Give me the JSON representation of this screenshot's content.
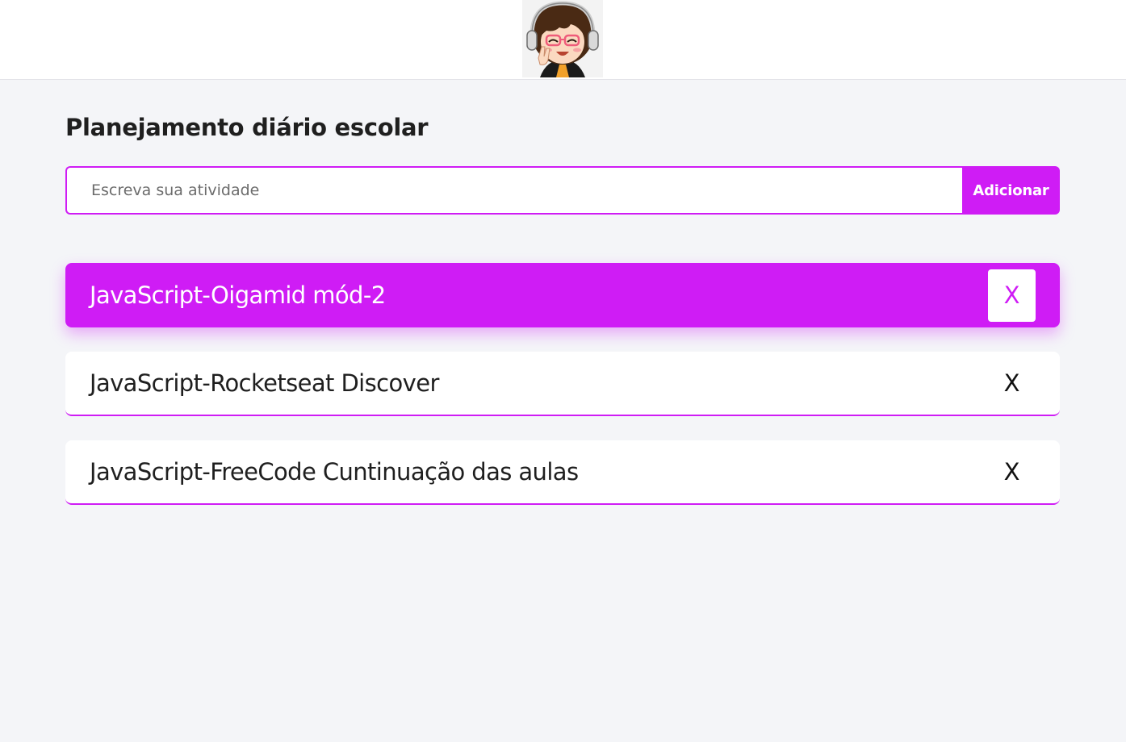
{
  "header": {
    "avatar_alt": "avatar"
  },
  "main": {
    "title": "Planejamento diário escolar",
    "input": {
      "placeholder": "Escreva sua atividade",
      "value": ""
    },
    "add_button_label": "Adicionar",
    "tasks": [
      {
        "label": "JavaScript-Oigamid mód-2",
        "done": true,
        "delete_label": "X"
      },
      {
        "label": "JavaScript-Rocketseat Discover",
        "done": false,
        "delete_label": "X"
      },
      {
        "label": "JavaScript-FreeCode Cuntinuação das aulas",
        "done": false,
        "delete_label": "X"
      }
    ]
  },
  "colors": {
    "accent": "#cf1cf5",
    "background": "#f4f5f8",
    "header_background": "#ffffff",
    "text": "#1f1f1f"
  },
  "icons": {
    "avatar": "girl-with-headphones-icon"
  }
}
